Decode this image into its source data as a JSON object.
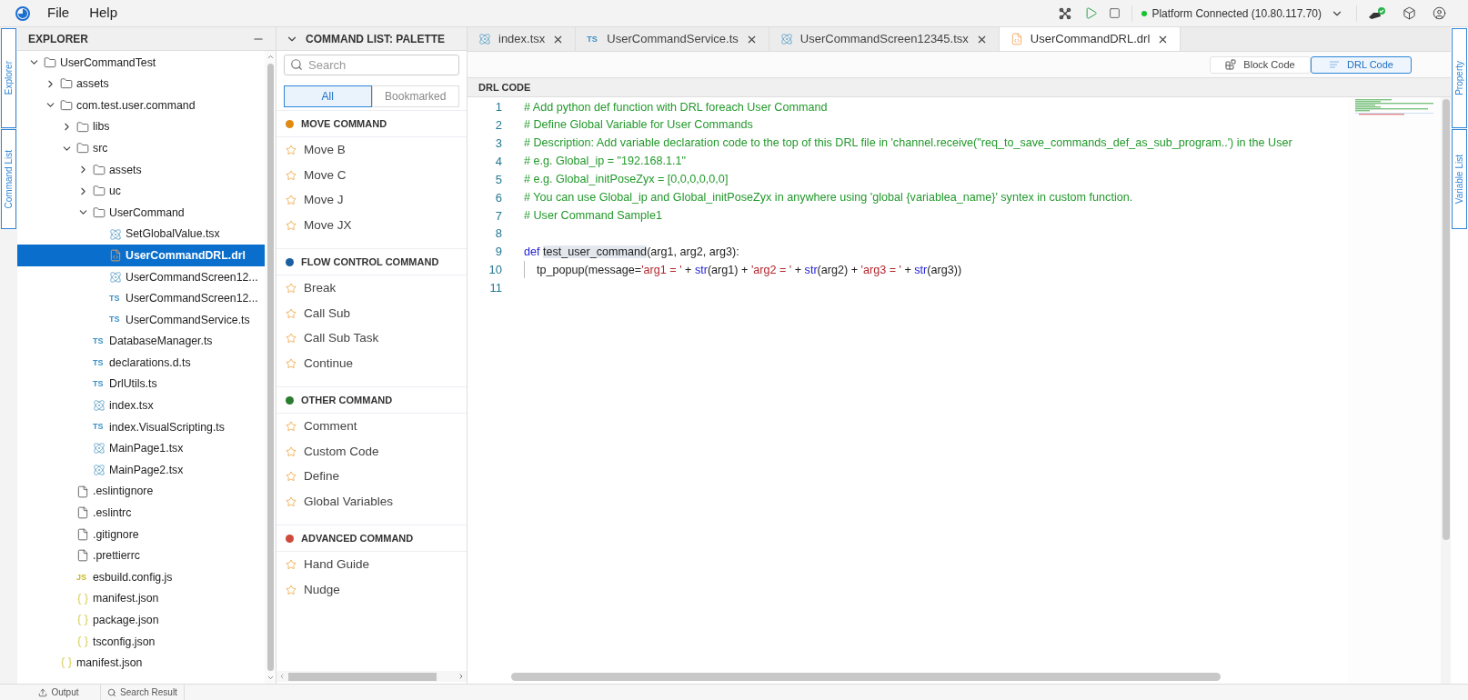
{
  "menu": [
    "File",
    "Help"
  ],
  "status": {
    "text": "Platform Connected (10.80.117.70)",
    "connected": true
  },
  "left_side_tabs": [
    {
      "label": "Explorer"
    },
    {
      "label": "Command List"
    }
  ],
  "right_side_tabs": [
    {
      "label": "Property"
    },
    {
      "label": "Variable List"
    }
  ],
  "explorer": {
    "title": "EXPLORER",
    "tree": [
      {
        "label": "UserCommandTest",
        "kind": "folder",
        "expanded": true,
        "selected": false,
        "children": [
          {
            "label": "assets",
            "kind": "folder",
            "expanded": false,
            "selected": false
          },
          {
            "label": "com.test.user.command",
            "kind": "folder",
            "expanded": true,
            "selected": false,
            "children": [
              {
                "label": "libs",
                "kind": "folder",
                "expanded": false,
                "selected": false
              },
              {
                "label": "src",
                "kind": "folder",
                "expanded": true,
                "selected": false,
                "children": [
                  {
                    "label": "assets",
                    "kind": "folder",
                    "expanded": false,
                    "selected": false
                  },
                  {
                    "label": "uc",
                    "kind": "folder",
                    "expanded": false,
                    "selected": false
                  },
                  {
                    "label": "UserCommand",
                    "kind": "folder",
                    "expanded": true,
                    "selected": false,
                    "children": [
                      {
                        "label": "SetGlobalValue.tsx",
                        "kind": "react",
                        "selected": false
                      },
                      {
                        "label": "UserCommandDRL.drl",
                        "kind": "drl",
                        "selected": true
                      },
                      {
                        "label": "UserCommandScreen12...",
                        "kind": "react",
                        "selected": false
                      },
                      {
                        "label": "UserCommandScreen12...",
                        "kind": "ts",
                        "badge": "TS",
                        "selected": false
                      },
                      {
                        "label": "UserCommandService.ts",
                        "kind": "ts",
                        "badge": "TS",
                        "selected": false
                      }
                    ]
                  },
                  {
                    "label": "DatabaseManager.ts",
                    "kind": "ts",
                    "badge": "TS",
                    "selected": false
                  },
                  {
                    "label": "declarations.d.ts",
                    "kind": "ts",
                    "badge": "TS",
                    "selected": false
                  },
                  {
                    "label": "DrlUtils.ts",
                    "kind": "ts",
                    "badge": "TS",
                    "selected": false
                  },
                  {
                    "label": "index.tsx",
                    "kind": "react",
                    "selected": false
                  },
                  {
                    "label": "index.VisualScripting.ts",
                    "kind": "ts",
                    "badge": "TS",
                    "selected": false
                  },
                  {
                    "label": "MainPage1.tsx",
                    "kind": "react",
                    "selected": false
                  },
                  {
                    "label": "MainPage2.tsx",
                    "kind": "react",
                    "selected": false
                  }
                ]
              },
              {
                "label": ".eslintignore",
                "kind": "file",
                "selected": false
              },
              {
                "label": ".eslintrc",
                "kind": "file",
                "selected": false
              },
              {
                "label": ".gitignore",
                "kind": "file",
                "selected": false
              },
              {
                "label": ".prettierrc",
                "kind": "file",
                "selected": false
              },
              {
                "label": "esbuild.config.js",
                "kind": "js",
                "badge": "JS",
                "selected": false
              },
              {
                "label": "manifest.json",
                "kind": "json",
                "selected": false
              },
              {
                "label": "package.json",
                "kind": "json",
                "selected": false
              },
              {
                "label": "tsconfig.json",
                "kind": "json",
                "selected": false
              }
            ]
          },
          {
            "label": "manifest.json",
            "kind": "json",
            "selected": false
          }
        ]
      }
    ]
  },
  "command_list": {
    "title": "COMMAND LIST: PALETTE",
    "search": {
      "placeholder": "Search"
    },
    "filters": [
      {
        "label": "All",
        "selected": true
      },
      {
        "label": "Bookmarked",
        "selected": false
      }
    ],
    "groups": [
      {
        "title": "MOVE COMMAND",
        "color": "#e08a12",
        "items": [
          "Move B",
          "Move C",
          "Move J",
          "Move JX"
        ]
      },
      {
        "title": "FLOW CONTROL COMMAND",
        "color": "#1a5fa0",
        "items": [
          "Break",
          "Call Sub",
          "Call Sub Task",
          "Continue"
        ]
      },
      {
        "title": "OTHER COMMAND",
        "color": "#2a7d2e",
        "items": [
          "Comment",
          "Custom Code",
          "Define",
          "Global Variables"
        ]
      },
      {
        "title": "ADVANCED COMMAND",
        "color": "#d0493a",
        "items": [
          "Hand Guide",
          "Nudge"
        ]
      }
    ]
  },
  "editor_tabs": [
    {
      "label": "index.tsx",
      "kind": "react",
      "selected": false
    },
    {
      "label": "UserCommandService.ts",
      "kind": "ts",
      "badge": "TS",
      "selected": false
    },
    {
      "label": "UserCommandScreen12345.tsx",
      "kind": "react",
      "selected": false
    },
    {
      "label": "UserCommandDRL.drl",
      "kind": "drl",
      "selected": true
    }
  ],
  "view_toggle": [
    {
      "label": "Block Code",
      "kind": "block",
      "selected": false
    },
    {
      "label": "DRL Code",
      "kind": "drl",
      "selected": true
    }
  ],
  "code": {
    "title": "DRL CODE",
    "lines": [
      {
        "number": "1",
        "tokens": [
          {
            "kind": "comment",
            "text": "# Add python def function with DRL foreach User Command"
          }
        ]
      },
      {
        "number": "2",
        "tokens": [
          {
            "kind": "comment",
            "text": "# Define Global Variable for User Commands"
          }
        ]
      },
      {
        "number": "3",
        "tokens": [
          {
            "kind": "comment",
            "text": "# Description: Add variable declaration code to the top of this DRL file in 'channel.receive(\"req_to_save_commands_def_as_sub_program..') in the User"
          }
        ]
      },
      {
        "number": "4",
        "tokens": [
          {
            "kind": "comment",
            "text": "# e.g. Global_ip = \"192.168.1.1\""
          }
        ]
      },
      {
        "number": "5",
        "tokens": [
          {
            "kind": "comment",
            "text": "# e.g. Global_initPoseZyx = [0,0,0,0,0,0]"
          }
        ]
      },
      {
        "number": "6",
        "tokens": [
          {
            "kind": "comment",
            "text": "# You can use Global_ip and Global_initPoseZyx in anywhere using 'global {variablea_name}' syntex in custom function."
          }
        ]
      },
      {
        "number": "7",
        "tokens": [
          {
            "kind": "comment",
            "text": "# User Command Sample1"
          }
        ]
      },
      {
        "number": "8"
      },
      {
        "number": "9",
        "tokens": [
          {
            "kind": "keyword",
            "text": "def "
          },
          {
            "kind": "highlight",
            "text": "test_user_command"
          },
          {
            "kind": "plain",
            "text": "(arg1, arg2, arg3):"
          }
        ]
      },
      {
        "number": "10",
        "tokens": [
          {
            "kind": "indent"
          },
          {
            "kind": "plain",
            "text": "tp_popup(message="
          },
          {
            "kind": "string",
            "text": "'arg1 = '"
          },
          {
            "kind": "plain",
            "text": " + "
          },
          {
            "kind": "builtin",
            "text": "str"
          },
          {
            "kind": "plain",
            "text": "(arg1) + "
          },
          {
            "kind": "string",
            "text": "'arg2 = '"
          },
          {
            "kind": "plain",
            "text": " + "
          },
          {
            "kind": "builtin",
            "text": "str"
          },
          {
            "kind": "plain",
            "text": "(arg2) + "
          },
          {
            "kind": "string",
            "text": "'arg3 = '"
          },
          {
            "kind": "plain",
            "text": " + "
          },
          {
            "kind": "builtin",
            "text": "str"
          },
          {
            "kind": "plain",
            "text": "(arg3))"
          }
        ]
      },
      {
        "number": "11"
      }
    ]
  },
  "bottom_tabs": [
    "Output",
    "Search Result"
  ]
}
